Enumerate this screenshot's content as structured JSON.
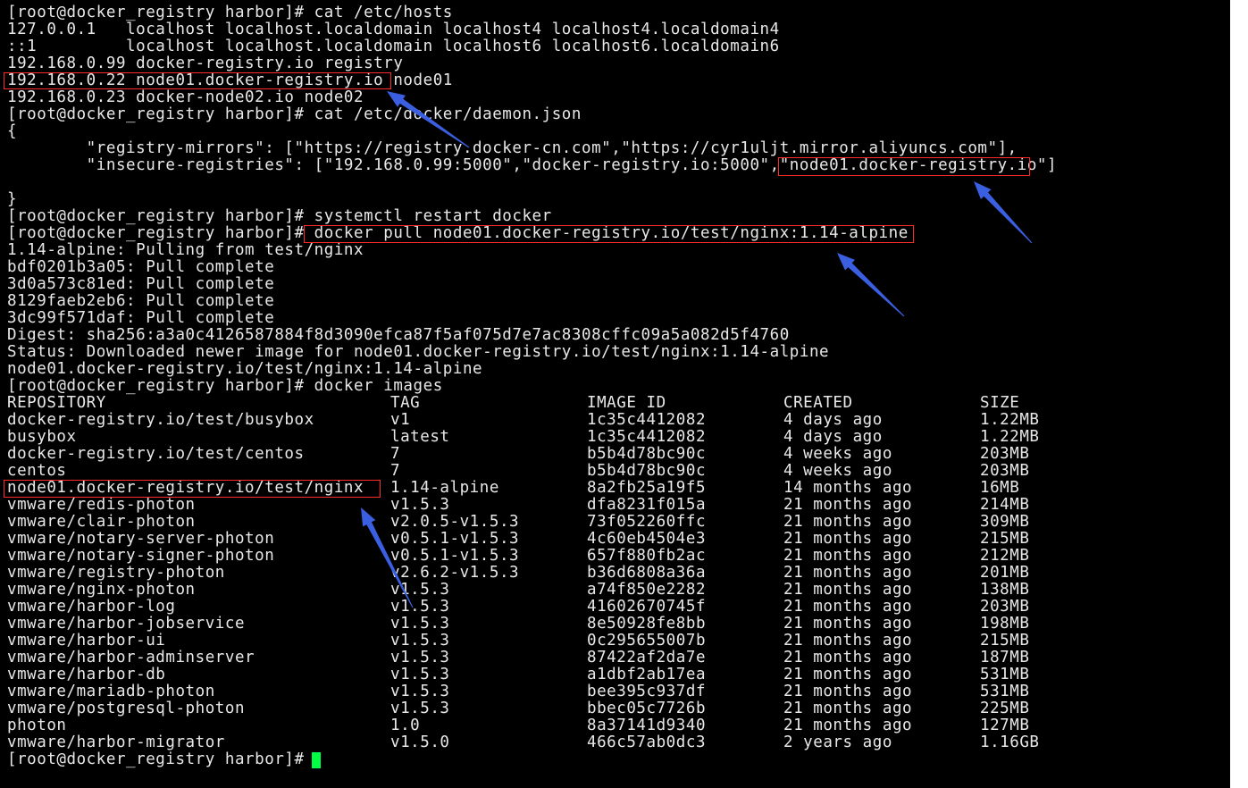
{
  "terminal": {
    "lines": [
      "[root@docker_registry harbor]# cat /etc/hosts",
      "127.0.0.1   localhost localhost.localdomain localhost4 localhost4.localdomain4",
      "::1         localhost localhost.localdomain localhost6 localhost6.localdomain6",
      "192.168.0.99 docker-registry.io registry",
      "192.168.0.22 node01.docker-registry.io node01",
      "192.168.0.23 docker-node02.io node02",
      "[root@docker_registry harbor]# cat /etc/docker/daemon.json",
      "{",
      "        \"registry-mirrors\": [\"https://registry.docker-cn.com\",\"https://cyr1uljt.mirror.aliyuncs.com\"],",
      "        \"insecure-registries\": [\"192.168.0.99:5000\",\"docker-registry.io:5000\",\"node01.docker-registry.io\"]",
      "",
      "}",
      "[root@docker_registry harbor]# systemctl restart docker",
      "[root@docker_registry harbor]# docker pull node01.docker-registry.io/test/nginx:1.14-alpine",
      "1.14-alpine: Pulling from test/nginx",
      "bdf0201b3a05: Pull complete",
      "3d0a573c81ed: Pull complete",
      "8129faeb2eb6: Pull complete",
      "3dc99f571daf: Pull complete",
      "Digest: sha256:a3a0c4126587884f8d3090efca87f5af075d7e7ac8308cffc09a5a082d5f4760",
      "Status: Downloaded newer image for node01.docker-registry.io/test/nginx:1.14-alpine",
      "node01.docker-registry.io/test/nginx:1.14-alpine",
      "[root@docker_registry harbor]# docker images"
    ],
    "images_header": [
      "REPOSITORY",
      "TAG",
      "IMAGE ID",
      "CREATED",
      "SIZE"
    ],
    "images_rows": [
      [
        "docker-registry.io/test/busybox",
        "v1",
        "1c35c4412082",
        "4 days ago",
        "1.22MB"
      ],
      [
        "busybox",
        "latest",
        "1c35c4412082",
        "4 days ago",
        "1.22MB"
      ],
      [
        "docker-registry.io/test/centos",
        "7",
        "b5b4d78bc90c",
        "4 weeks ago",
        "203MB"
      ],
      [
        "centos",
        "7",
        "b5b4d78bc90c",
        "4 weeks ago",
        "203MB"
      ],
      [
        "node01.docker-registry.io/test/nginx",
        "1.14-alpine",
        "8a2fb25a19f5",
        "14 months ago",
        "16MB"
      ],
      [
        "vmware/redis-photon",
        "v1.5.3",
        "dfa8231f015a",
        "21 months ago",
        "214MB"
      ],
      [
        "vmware/clair-photon",
        "v2.0.5-v1.5.3",
        "73f052260ffc",
        "21 months ago",
        "309MB"
      ],
      [
        "vmware/notary-server-photon",
        "v0.5.1-v1.5.3",
        "4c60eb4504e3",
        "21 months ago",
        "215MB"
      ],
      [
        "vmware/notary-signer-photon",
        "v0.5.1-v1.5.3",
        "657f880fb2ac",
        "21 months ago",
        "212MB"
      ],
      [
        "vmware/registry-photon",
        "v2.6.2-v1.5.3",
        "b36d6808a36a",
        "21 months ago",
        "201MB"
      ],
      [
        "vmware/nginx-photon",
        "v1.5.3",
        "a74f850e2282",
        "21 months ago",
        "138MB"
      ],
      [
        "vmware/harbor-log",
        "v1.5.3",
        "41602670745f",
        "21 months ago",
        "203MB"
      ],
      [
        "vmware/harbor-jobservice",
        "v1.5.3",
        "8e50928fe8bb",
        "21 months ago",
        "198MB"
      ],
      [
        "vmware/harbor-ui",
        "v1.5.3",
        "0c295655007b",
        "21 months ago",
        "215MB"
      ],
      [
        "vmware/harbor-adminserver",
        "v1.5.3",
        "87422af2da7e",
        "21 months ago",
        "187MB"
      ],
      [
        "vmware/harbor-db",
        "v1.5.3",
        "a1dbf2ab17ea",
        "21 months ago",
        "531MB"
      ],
      [
        "vmware/mariadb-photon",
        "v1.5.3",
        "bee395c937df",
        "21 months ago",
        "531MB"
      ],
      [
        "vmware/postgresql-photon",
        "v1.5.3",
        "bbec05c7726b",
        "21 months ago",
        "225MB"
      ],
      [
        "photon",
        "1.0",
        "8a37141d9340",
        "21 months ago",
        "127MB"
      ],
      [
        "vmware/harbor-migrator",
        "v1.5.0",
        "466c57ab0dc3",
        "2 years ago",
        "1.16GB"
      ]
    ],
    "final_prompt": "[root@docker_registry harbor]# ",
    "colors": {
      "background": "#000000",
      "text": "#e8e8e8",
      "highlight_box": "#ff2a2a",
      "arrow": "#3a5fe0",
      "cursor": "#00ff44"
    }
  }
}
